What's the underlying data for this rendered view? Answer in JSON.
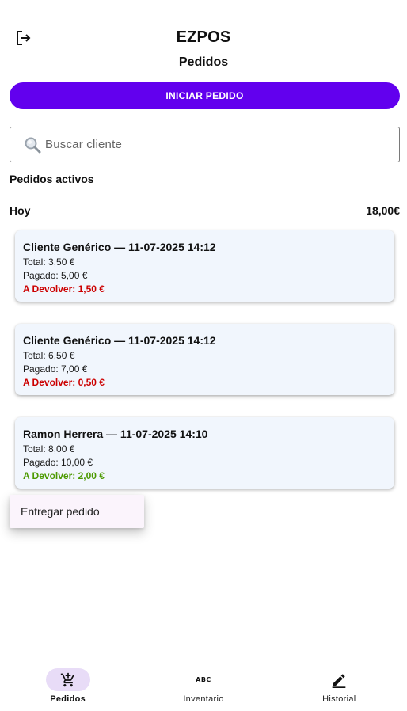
{
  "app": {
    "title": "EZPOS",
    "page_title": "Pedidos"
  },
  "header": {
    "logout_icon": "logout-icon"
  },
  "actions": {
    "start_order_label": "INICIAR PEDIDO"
  },
  "search": {
    "placeholder": "Buscar cliente",
    "icon": "magnifier-icon"
  },
  "section": {
    "active_orders_label": "Pedidos activos"
  },
  "group": {
    "label": "Hoy",
    "total": "18,00€"
  },
  "orders": [
    {
      "title": "Cliente Genérico — 11-07-2025 14:12",
      "total": "Total: 3,50 €",
      "paid": "Pagado: 5,00 €",
      "refund": "A Devolver: 1,50 €",
      "refund_color": "#cc0000"
    },
    {
      "title": "Cliente Genérico — 11-07-2025 14:12",
      "total": "Total: 6,50 €",
      "paid": "Pagado: 7,00 €",
      "refund": "A Devolver: 0,50 €",
      "refund_color": "#cc0000"
    },
    {
      "title": "Ramon Herrera — 11-07-2025 14:10",
      "total": "Total: 8,00 €",
      "paid": "Pagado: 10,00 €",
      "refund": "A Devolver: 2,00 €",
      "refund_color": "#4c9a00"
    }
  ],
  "context_menu": {
    "item_label": "Entregar pedido"
  },
  "nav": {
    "items": [
      {
        "label": "Pedidos",
        "icon": "add-shopping-cart-icon",
        "active": true
      },
      {
        "label": "Inventario",
        "icon": "abc-icon",
        "active": false,
        "glyph": "ABC"
      },
      {
        "label": "Historial",
        "icon": "edit-icon",
        "active": false
      }
    ]
  },
  "colors": {
    "accent": "#6200ee",
    "card_bg": "#f1f6fd",
    "active_nav_bg": "#e8dcf7",
    "refund_red": "#cc0000",
    "refund_green": "#4c9a00"
  }
}
